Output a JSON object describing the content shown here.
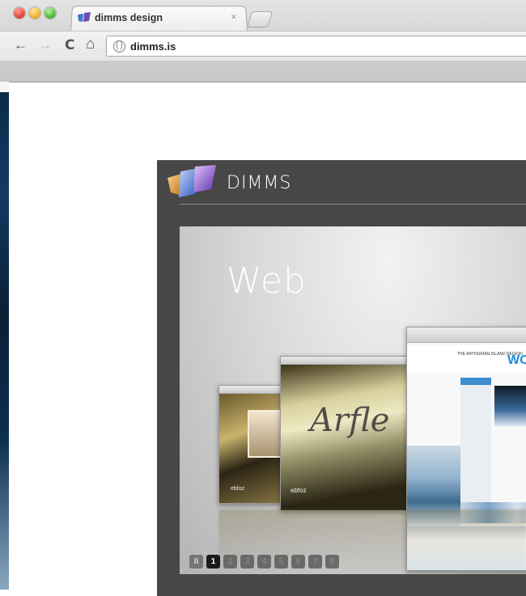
{
  "browser": {
    "tab": {
      "title": "dimms design",
      "close_glyph": "×"
    },
    "nav": {
      "back": "←",
      "forward": "→",
      "reload": "C",
      "home": "⌂"
    },
    "address": {
      "url": "dimms.is"
    }
  },
  "site": {
    "brand": "DIMMS",
    "slide": {
      "title": "Web",
      "screens": {
        "s1_mark": "ebfoz",
        "s2_mark": "ebfoz",
        "s2_script": "Arfle",
        "s3_header": "THE ARTHURIAN ISLAND REGION",
        "s3_big": "WO"
      }
    },
    "pager": [
      {
        "label": "II",
        "kind": "pause"
      },
      {
        "label": "1",
        "kind": "active"
      },
      {
        "label": "2",
        "kind": "normal"
      },
      {
        "label": "3",
        "kind": "normal"
      },
      {
        "label": "4",
        "kind": "normal"
      },
      {
        "label": "5",
        "kind": "normal"
      },
      {
        "label": "6",
        "kind": "normal"
      },
      {
        "label": "7",
        "kind": "normal"
      },
      {
        "label": "8",
        "kind": "normal"
      }
    ]
  },
  "colors": {
    "site_bg": "#474747",
    "active_page": "#1b1b1b",
    "link_blue": "#1a8fd8"
  }
}
